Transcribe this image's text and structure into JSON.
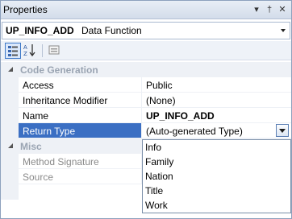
{
  "window": {
    "title": "Properties",
    "pin_glyph": "▾",
    "autohide_glyph": "†",
    "close_glyph": "✕"
  },
  "object_selector": {
    "name": "UP_INFO_ADD",
    "type": "Data Function"
  },
  "toolbar": {
    "buttons": [
      {
        "icon": "categorized-icon",
        "active": true
      },
      {
        "icon": "alphabetical-icon",
        "active": false
      },
      {
        "icon": "property-pages-icon",
        "active": false
      }
    ]
  },
  "grid": {
    "categories": [
      {
        "label": "Code Generation",
        "properties": [
          {
            "name": "Access",
            "value": "Public"
          },
          {
            "name": "Inheritance Modifier",
            "value": "(None)"
          },
          {
            "name": "Name",
            "value": "UP_INFO_ADD"
          },
          {
            "name": "Return Type",
            "value": "(Auto-generated Type)"
          }
        ]
      },
      {
        "label": "Misc",
        "properties": [
          {
            "name": "Method Signature",
            "value": ""
          },
          {
            "name": "Source",
            "value": ""
          }
        ]
      }
    ]
  },
  "dropdown": {
    "options": [
      "Info",
      "Family",
      "Nation",
      "Title",
      "Work"
    ]
  },
  "colors": {
    "selection": "#3b6fc3",
    "category_bg": "#eef1f6",
    "titlebar_top": "#e9eef6",
    "titlebar_bottom": "#d3dcea"
  }
}
